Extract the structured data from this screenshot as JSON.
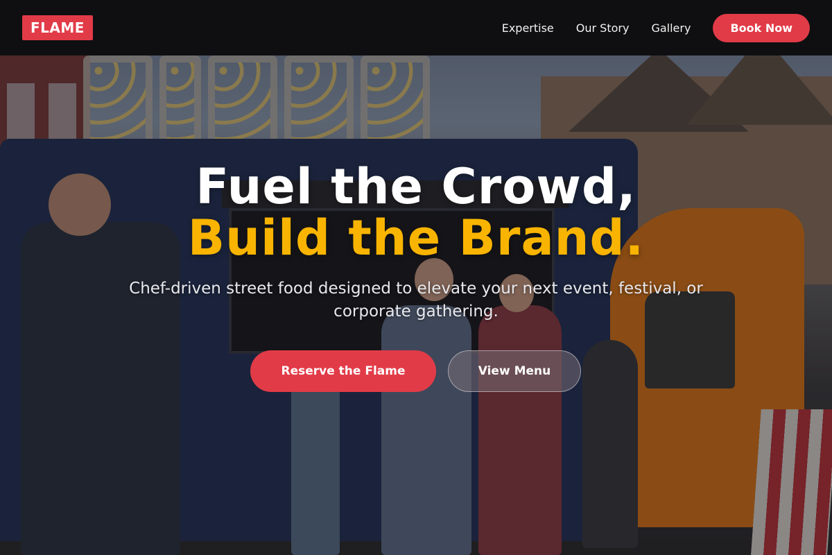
{
  "nav": {
    "logo": "FLAME",
    "links": [
      "Expertise",
      "Our Story",
      "Gallery"
    ],
    "cta": "Book Now"
  },
  "hero": {
    "headline_line1": "Fuel the Crowd,",
    "headline_line2": "Build the Brand.",
    "subtitle": "Chef-driven street food designed to elevate your next event, festival, or corporate gathering.",
    "primary_cta": "Reserve the Flame",
    "secondary_cta": "View Menu"
  },
  "colors": {
    "accent": "#e23b48",
    "highlight": "#f8b400",
    "nav_bg": "#0f0f11"
  }
}
